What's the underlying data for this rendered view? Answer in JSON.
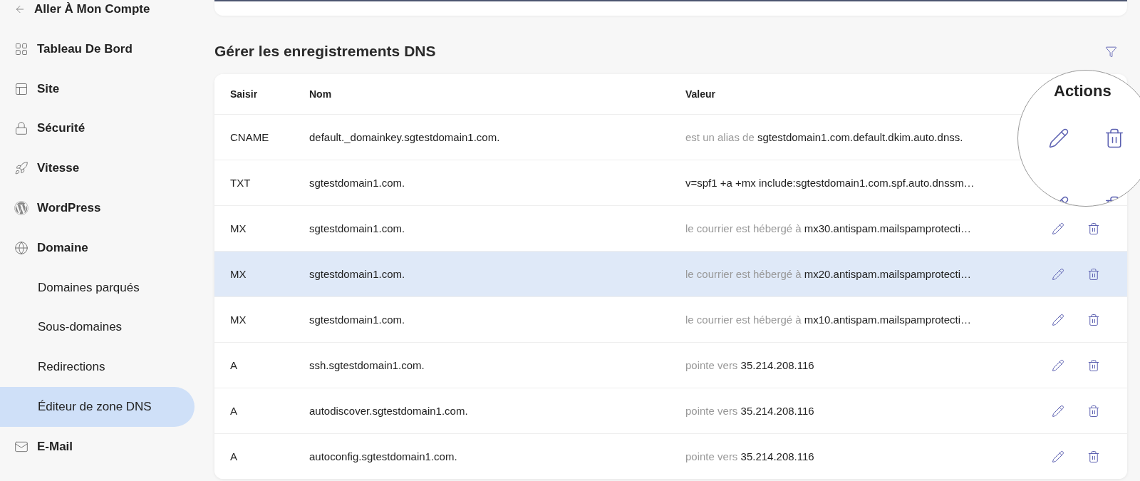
{
  "sidebar": {
    "items": [
      {
        "kind": "back",
        "label": "Aller À Mon Compte",
        "selected": false
      },
      {
        "kind": "section",
        "label": "Tableau De Bord",
        "selected": false
      },
      {
        "kind": "section",
        "label": "Site",
        "selected": false
      },
      {
        "kind": "section",
        "label": "Sécurité",
        "selected": false
      },
      {
        "kind": "section",
        "label": "Vitesse",
        "selected": false
      },
      {
        "kind": "section",
        "label": "WordPress",
        "selected": false
      },
      {
        "kind": "section",
        "label": "Domaine",
        "selected": false
      },
      {
        "kind": "subitem",
        "label": "Domaines parqués",
        "selected": false
      },
      {
        "kind": "subitem",
        "label": "Sous-domaines",
        "selected": false
      },
      {
        "kind": "subitem",
        "label": "Redirections",
        "selected": false
      },
      {
        "kind": "subitem",
        "label": "Éditeur de zone DNS",
        "selected": true
      },
      {
        "kind": "section",
        "label": "E-Mail",
        "selected": false
      }
    ]
  },
  "section": {
    "title": "Gérer les enregistrements DNS"
  },
  "table": {
    "columns": [
      "Saisir",
      "Nom",
      "Valeur"
    ],
    "rows": [
      {
        "type": "CNAME",
        "name": "default._domainkey.sgtestdomain1.com.",
        "value_prefix": "est un alias de",
        "value": "sgtestdomain1.com.default.dkim.auto.dnss.",
        "selected": false,
        "in_lens": true
      },
      {
        "type": "TXT",
        "name": "sgtestdomain1.com.",
        "value": "v=spf1 +a +mx include:sgtestdomain1.com.spf.auto.dnssm…",
        "selected": false,
        "in_lens": true
      },
      {
        "type": "MX",
        "name": "sgtestdomain1.com.",
        "value_prefix": "le courrier est hébergé à",
        "value": "mx30.antispam.mailspamprotecti…",
        "selected": false,
        "in_lens": false
      },
      {
        "type": "MX",
        "name": "sgtestdomain1.com.",
        "value_prefix": "le courrier est hébergé à",
        "value": "mx20.antispam.mailspamprotecti…",
        "selected": true,
        "in_lens": false
      },
      {
        "type": "MX",
        "name": "sgtestdomain1.com.",
        "value_prefix": "le courrier est hébergé à",
        "value": "mx10.antispam.mailspamprotecti…",
        "selected": false,
        "in_lens": false
      },
      {
        "type": "A",
        "name": "ssh.sgtestdomain1.com.",
        "value_prefix": "pointe vers",
        "value": "35.214.208.116",
        "selected": false,
        "in_lens": false
      },
      {
        "type": "A",
        "name": "autodiscover.sgtestdomain1.com.",
        "value_prefix": "pointe vers",
        "value": "35.214.208.116",
        "selected": false,
        "in_lens": false
      },
      {
        "type": "A",
        "name": "autoconfig.sgtestdomain1.com.",
        "value_prefix": "pointe vers",
        "value": "35.214.208.116",
        "selected": false,
        "in_lens": false
      }
    ]
  },
  "lens": {
    "header": "Actions"
  }
}
